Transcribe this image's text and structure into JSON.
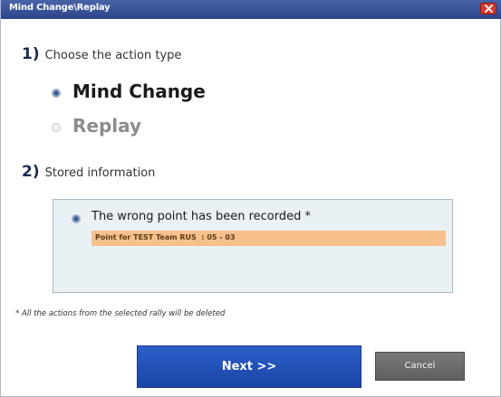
{
  "window": {
    "title": "Mind Change\\Replay",
    "close_icon": "close-x-icon"
  },
  "step1": {
    "number": "1)",
    "label": "Choose the action type"
  },
  "action_options": [
    {
      "label": "Mind Change",
      "selected": true
    },
    {
      "label": "Replay",
      "selected": false
    }
  ],
  "step2": {
    "number": "2)",
    "label": "Stored information"
  },
  "stored_info": {
    "entry_text": "The wrong point has been recorded *",
    "selected": true,
    "point_text": "Point for TEST Team RUS  : 05 - 03"
  },
  "footnote": "* All the actions from the selected rally will be deleted",
  "buttons": {
    "next_label": "Next >>",
    "cancel_label": "Cancel"
  },
  "colors": {
    "titlebar": "#2c4489",
    "close": "#d23b2c",
    "next_button": "#1f4fb6",
    "cancel_button": "#6b6b6b",
    "info_box_bg": "#eaf1f5",
    "highlight_bar": "#f7c08c"
  }
}
